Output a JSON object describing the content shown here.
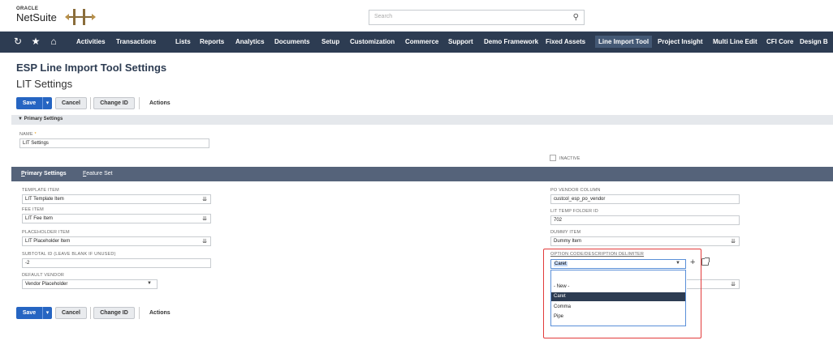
{
  "brand": {
    "oracle": "ORACLE",
    "netsuite": "NetSuite"
  },
  "search": {
    "placeholder": "Search"
  },
  "nav": {
    "items": [
      {
        "label": "Activities"
      },
      {
        "label": "Transactions"
      },
      {
        "label": "Lists"
      },
      {
        "label": "Reports"
      },
      {
        "label": "Analytics"
      },
      {
        "label": "Documents"
      },
      {
        "label": "Setup"
      },
      {
        "label": "Customization"
      },
      {
        "label": "Commerce"
      },
      {
        "label": "Support"
      },
      {
        "label": "Demo Framework"
      },
      {
        "label": "Fixed Assets"
      },
      {
        "label": "Line Import Tool"
      },
      {
        "label": "Project Insight"
      },
      {
        "label": "Multi Line Edit"
      },
      {
        "label": "CFI Core"
      },
      {
        "label": "Design B"
      }
    ],
    "active": "Line Import Tool"
  },
  "page": {
    "title": "ESP Line Import Tool Settings",
    "subtitle": "LIT Settings"
  },
  "toolbar": {
    "save": "Save",
    "cancel": "Cancel",
    "change_id": "Change ID",
    "actions": "Actions"
  },
  "primary_section": {
    "label": "Primary Settings"
  },
  "fields": {
    "name": {
      "label": "NAME",
      "required_mark": "*",
      "value": "LIT Settings"
    },
    "inactive": {
      "label": "INACTIVE"
    },
    "template_item": {
      "label": "TEMPLATE ITEM",
      "value": "LIT Template Item"
    },
    "fee_item": {
      "label": "FEE ITEM",
      "value": "LIT Fee Item"
    },
    "placeholder_item": {
      "label": "PLACEHOLDER ITEM",
      "value": "LIT Placeholder Item"
    },
    "subtotal_id": {
      "label": "SUBTOTAL ID (LEAVE BLANK IF UNUSED)",
      "value": "-2"
    },
    "default_vendor": {
      "label": "DEFAULT VENDOR",
      "value": "Vendor Placeholder"
    },
    "po_vendor_column": {
      "label": "PO VENDOR COLUMN",
      "value": "custcol_esp_po_vendor"
    },
    "lit_temp_folder_id": {
      "label": "LIT TEMP FOLDER ID",
      "value": "702"
    },
    "dummy_item": {
      "label": "DUMMY ITEM",
      "value": "Dummy Item"
    },
    "option_delimiter": {
      "label": "OPTION CODE/DESCRIPTION DELIMITER",
      "value": "Caret",
      "options": [
        "",
        "- New -",
        "Caret",
        "Comma",
        "Pipe"
      ],
      "highlighted": "Caret"
    }
  },
  "subtabs": [
    {
      "label": "Primary Settings",
      "key": "P"
    },
    {
      "label": "Feature Set",
      "key": "F"
    }
  ]
}
